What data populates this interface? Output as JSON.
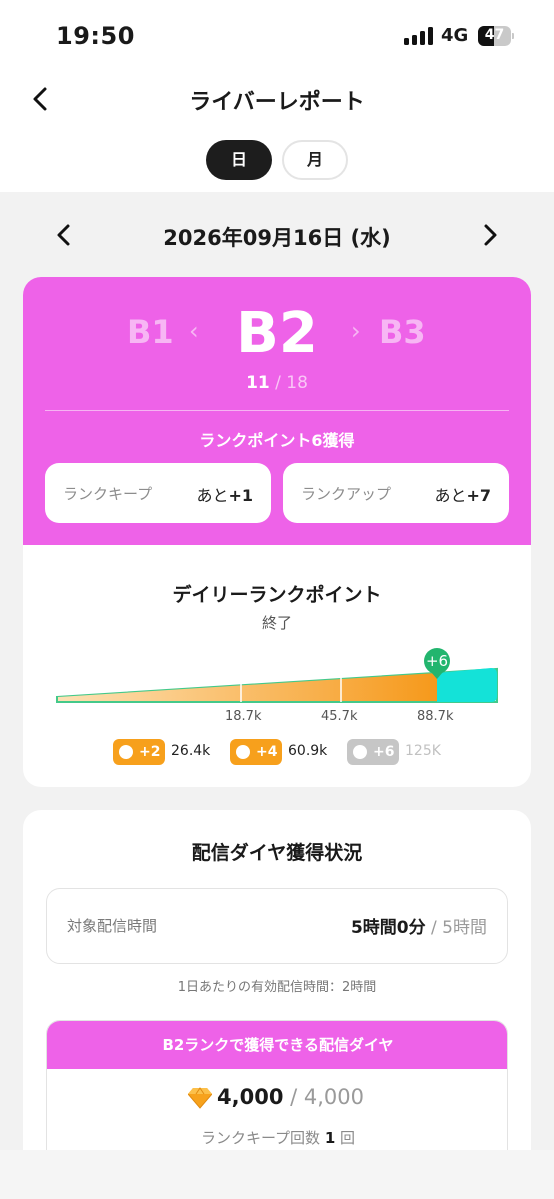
{
  "status_bar": {
    "time": "19:50",
    "network": "4G",
    "battery": "47"
  },
  "header": {
    "title": "ライバーレポート"
  },
  "tabs": [
    {
      "label": "日",
      "active": true
    },
    {
      "label": "月",
      "active": false
    }
  ],
  "date": {
    "label": "2026年09月16日 (水)"
  },
  "rank": {
    "previous": "B1",
    "current": "B2",
    "next": "B3",
    "progress_current": "11",
    "progress_total": "/ 18",
    "points_earned": "ランクポイント6獲得",
    "keep": {
      "label": "ランクキープ",
      "prefix": "あと",
      "value": "+1"
    },
    "up": {
      "label": "ランクアップ",
      "prefix": "あと",
      "value": "+7"
    },
    "accent_color": "#ee62e8"
  },
  "daily_rank": {
    "title": "デイリーランクポイント",
    "status": "終了",
    "marker": "+6",
    "ticks": [
      "18.7k",
      "45.7k",
      "88.7k"
    ],
    "progress_fraction": 0.8,
    "badges": [
      {
        "points": "+2",
        "threshold": "26.4k",
        "achieved": true
      },
      {
        "points": "+4",
        "threshold": "60.9k",
        "achieved": true
      },
      {
        "points": "+6",
        "threshold": "125K",
        "achieved": false
      }
    ]
  },
  "diamond": {
    "title": "配信ダイヤ獲得状況",
    "time_label": "対象配信時間",
    "time_value": "5時間0分",
    "time_target": "/ 5時間",
    "effective_note": "1日あたりの有効配信時間：2時間",
    "earn_header": "B2ランクで獲得できる配信ダイヤ",
    "earn_value": "4,000",
    "earn_total": "/ 4,000",
    "keep_count_label": "ランクキープ回数",
    "keep_count_value": "1",
    "keep_count_unit": "回"
  }
}
